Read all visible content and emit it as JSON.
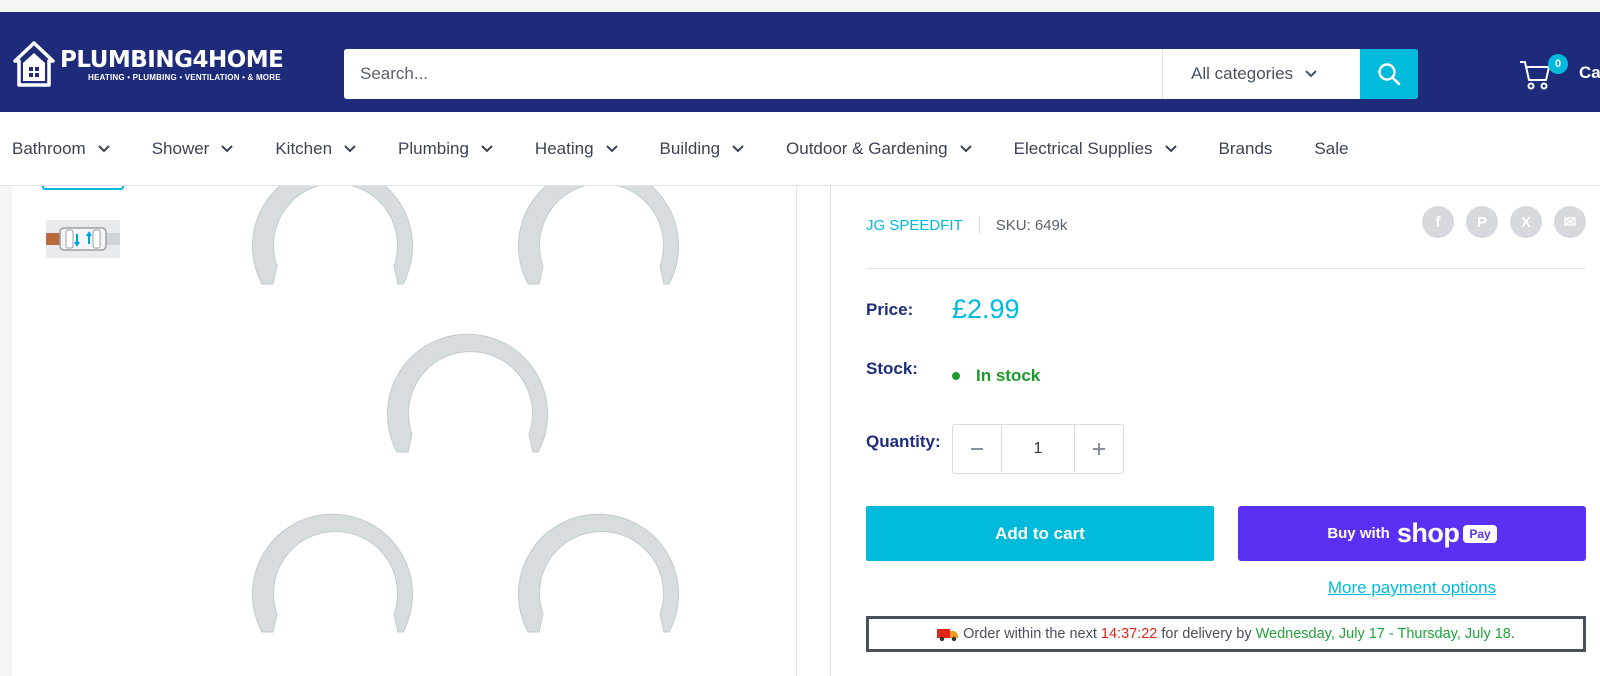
{
  "header": {
    "logo_main": "PLUMBING4HOME",
    "logo_sub": "HEATING • PLUMBING • VENTILATION • & MORE",
    "search_placeholder": "Search...",
    "category_select": "All categories",
    "cart_count": "0",
    "cart_label": "Ca"
  },
  "nav": {
    "items": [
      {
        "label": "Bathroom",
        "has_dropdown": true
      },
      {
        "label": "Shower",
        "has_dropdown": true
      },
      {
        "label": "Kitchen",
        "has_dropdown": true
      },
      {
        "label": "Plumbing",
        "has_dropdown": true
      },
      {
        "label": "Heating",
        "has_dropdown": true
      },
      {
        "label": "Building",
        "has_dropdown": true
      },
      {
        "label": "Outdoor & Gardening",
        "has_dropdown": true
      },
      {
        "label": "Electrical Supplies",
        "has_dropdown": true
      },
      {
        "label": "Brands",
        "has_dropdown": false
      },
      {
        "label": "Sale",
        "has_dropdown": false
      }
    ]
  },
  "product": {
    "brand": "JG SPEEDFIT",
    "sku": "SKU: 649k",
    "price_label": "Price:",
    "price": "£2.99",
    "stock_label": "Stock:",
    "stock_status": "In stock",
    "quantity_label": "Quantity:",
    "quantity": "1",
    "add_to_cart": "Add to cart",
    "buy_with": "Buy with",
    "shop_word": "shop",
    "pay_word": "Pay",
    "more_payment": "More payment options"
  },
  "delivery": {
    "prefix": "Order within the next",
    "countdown": "14:37:22",
    "middle": "for delivery by",
    "dates": "Wednesday, July 17 - Thursday, July 18",
    "suffix": "."
  },
  "colors": {
    "header_bg": "#1e2b7a",
    "accent": "#00badb",
    "shop_pay": "#5a31f4",
    "in_stock": "#1c9b2a",
    "countdown": "#e2231a"
  }
}
